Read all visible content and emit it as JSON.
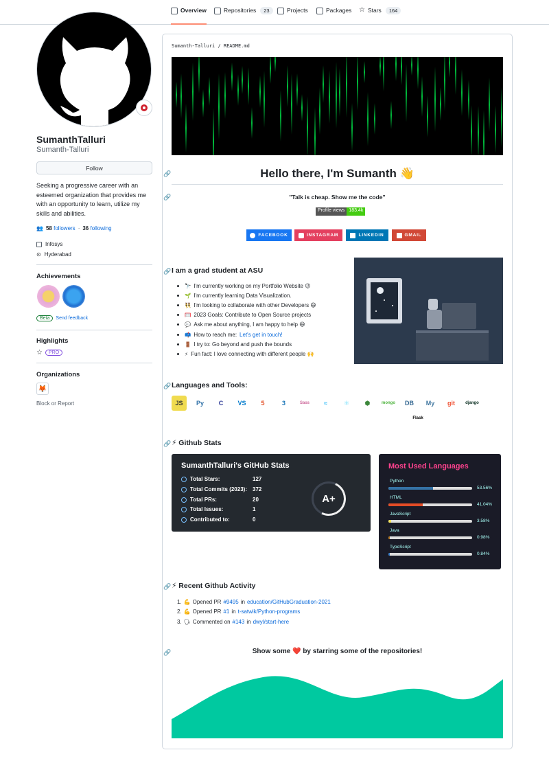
{
  "nav": {
    "tabs": [
      {
        "label": "Overview"
      },
      {
        "label": "Repositories",
        "count": "23"
      },
      {
        "label": "Projects"
      },
      {
        "label": "Packages"
      },
      {
        "label": "Stars",
        "count": "164"
      }
    ]
  },
  "profile": {
    "fullname": "SumanthTalluri",
    "username": "Sumanth-Talluri",
    "follow_label": "Follow",
    "bio": "Seeking a progressive career with an esteemed organization that provides me with an opportunity to learn, utilize my skills and abilities.",
    "followers_count": "58",
    "followers_label": "followers",
    "following_count": "36",
    "following_label": "following",
    "separator": "·",
    "company": "Infosys",
    "location": "Hyderabad"
  },
  "achievements": {
    "title": "Achievements",
    "beta_label": "Beta",
    "feedback_label": "Send feedback"
  },
  "highlights": {
    "title": "Highlights",
    "pro_label": "PRO"
  },
  "organizations": {
    "title": "Organizations",
    "block_label": "Block or Report"
  },
  "readme": {
    "path_user": "Sumanth-Talluri",
    "path_sep": "/",
    "path_file": "README.md",
    "heading": "Hello there, I'm Sumanth 👋",
    "quote": "\"Talk is cheap. Show me the code\"",
    "views_label": "Profile views",
    "views_value": "183.4k",
    "social": [
      {
        "label": "FACEBOOK",
        "color": "#1877f2"
      },
      {
        "label": "INSTAGRAM",
        "color": "#e4405f"
      },
      {
        "label": "LINKEDIN",
        "color": "#0077b5"
      },
      {
        "label": "GMAIL",
        "color": "#d14836"
      }
    ],
    "about_heading": "I am a grad student at ASU",
    "about_items": [
      {
        "emoji": "🔭",
        "text": "I'm currently working on my Portfolio Website 😉"
      },
      {
        "emoji": "🌱",
        "text": "I'm currently learning Data Visualization."
      },
      {
        "emoji": "👯",
        "text": "I'm looking to collaborate with other Developers 😄"
      },
      {
        "emoji": "🥅",
        "text": "2023 Goals: Contribute to Open Source projects"
      },
      {
        "emoji": "💬",
        "text": "Ask me about anything, I am happy to help 😄"
      },
      {
        "emoji": "📫",
        "text": "How to reach me:",
        "link": "Let's get in touch!"
      },
      {
        "emoji": "🚪",
        "text": "I try to: Go beyond and push the bounds"
      },
      {
        "emoji": "⚡",
        "text": "Fun fact: I love connecting with different people 🙌"
      }
    ],
    "tools_heading": "Languages and Tools:",
    "tools": [
      {
        "icon": "javascript-icon",
        "label": "JS",
        "color": "#f0db4f",
        "fg": "#323330"
      },
      {
        "icon": "python-icon",
        "label": "Py",
        "color": "#ffffff",
        "fg": "#3776ab"
      },
      {
        "icon": "c-icon",
        "label": "C",
        "color": "#ffffff",
        "fg": "#283593"
      },
      {
        "icon": "vscode-icon",
        "label": "VS",
        "color": "#ffffff",
        "fg": "#007acc"
      },
      {
        "icon": "html5-icon",
        "label": "5",
        "color": "#ffffff",
        "fg": "#e34f26"
      },
      {
        "icon": "css3-icon",
        "label": "3",
        "color": "#ffffff",
        "fg": "#1572b6"
      },
      {
        "icon": "sass-icon",
        "label": "Sass",
        "color": "#ffffff",
        "fg": "#cc6699"
      },
      {
        "icon": "tailwind-icon",
        "label": "≈",
        "color": "#ffffff",
        "fg": "#38bdf8"
      },
      {
        "icon": "react-icon",
        "label": "⚛",
        "color": "#ffffff",
        "fg": "#61dafb"
      },
      {
        "icon": "nodejs-icon",
        "label": "⬢",
        "color": "#ffffff",
        "fg": "#3c873a"
      },
      {
        "icon": "mongodb-icon",
        "label": "mongo",
        "color": "#ffffff",
        "fg": "#4db33d"
      },
      {
        "icon": "database-icon",
        "label": "DB",
        "color": "#ffffff",
        "fg": "#336791"
      },
      {
        "icon": "mysql-icon",
        "label": "My",
        "color": "#ffffff",
        "fg": "#4479a1"
      },
      {
        "icon": "git-icon",
        "label": "git",
        "color": "#ffffff",
        "fg": "#f05032"
      },
      {
        "icon": "django-icon",
        "label": "django",
        "color": "#ffffff",
        "fg": "#092e20"
      },
      {
        "icon": "flask-icon",
        "label": "Flask",
        "color": "#ffffff",
        "fg": "#000000"
      }
    ],
    "stats_heading": "⚡ Github Stats",
    "stats_title": "SumanthTalluri's GitHub Stats",
    "stats": [
      {
        "label": "Total Stars:",
        "value": "127"
      },
      {
        "label": "Total Commits (2023):",
        "value": "372"
      },
      {
        "label": "Total PRs:",
        "value": "20"
      },
      {
        "label": "Total Issues:",
        "value": "1"
      },
      {
        "label": "Contributed to:",
        "value": "0"
      }
    ],
    "grade": "A+",
    "langs_title": "Most Used Languages",
    "langs": [
      {
        "name": "Python",
        "pct": "53.56%",
        "value": 53.56,
        "color": "#3572A5"
      },
      {
        "name": "HTML",
        "pct": "41.04%",
        "value": 41.04,
        "color": "#e34c26"
      },
      {
        "name": "JavaScript",
        "pct": "3.58%",
        "value": 3.58,
        "color": "#f1e05a"
      },
      {
        "name": "Java",
        "pct": "0.98%",
        "value": 0.98,
        "color": "#b07219"
      },
      {
        "name": "TypeScript",
        "pct": "0.84%",
        "value": 0.84,
        "color": "#3178c6"
      }
    ],
    "activity_heading": "⚡ Recent Github Activity",
    "activity": [
      {
        "num": "1.",
        "emoji": "💪",
        "verb": "Opened PR",
        "ref": "#9495",
        "in": "in",
        "repo": "education/GitHubGraduation-2021"
      },
      {
        "num": "2.",
        "emoji": "💪",
        "verb": "Opened PR",
        "ref": "#1",
        "in": "in",
        "repo": "t-satwik/Python-programs"
      },
      {
        "num": "3.",
        "emoji": "🗣",
        "verb": "Commented on",
        "ref": "#143",
        "in": "in",
        "repo": "dwyl/start-here"
      }
    ],
    "star_prefix": "Show some",
    "star_heart": "❤️",
    "star_suffix": "by starring some of the repositories!",
    "wave_color": "#00c9a0"
  }
}
